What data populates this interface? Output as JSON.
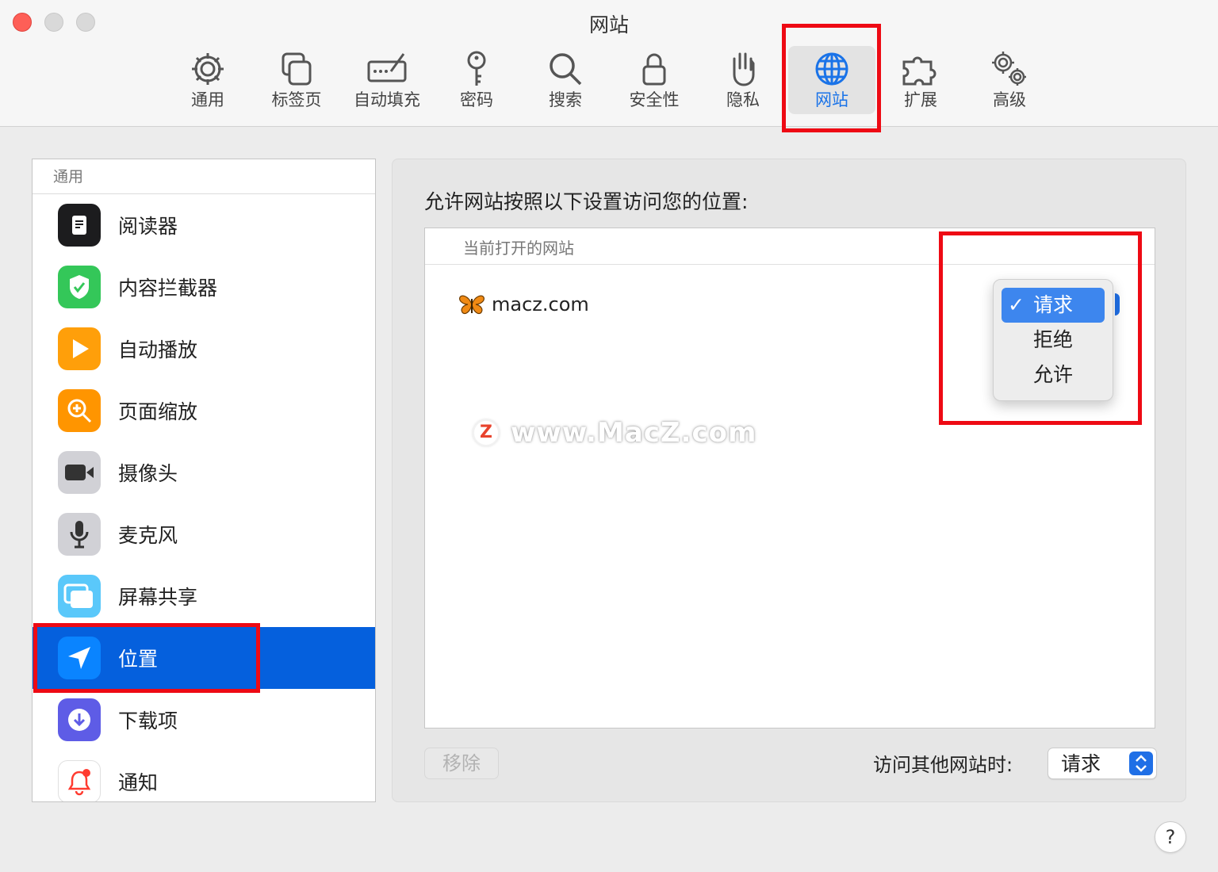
{
  "window": {
    "title": "网站"
  },
  "toolbar": {
    "items": [
      {
        "label": "通用",
        "icon": "gear-icon"
      },
      {
        "label": "标签页",
        "icon": "tabs-icon"
      },
      {
        "label": "自动填充",
        "icon": "autofill-icon"
      },
      {
        "label": "密码",
        "icon": "key-icon"
      },
      {
        "label": "搜索",
        "icon": "search-icon"
      },
      {
        "label": "安全性",
        "icon": "lock-icon"
      },
      {
        "label": "隐私",
        "icon": "hand-icon"
      },
      {
        "label": "网站",
        "icon": "globe-icon",
        "active": true
      },
      {
        "label": "扩展",
        "icon": "puzzle-icon"
      },
      {
        "label": "高级",
        "icon": "gears-icon"
      }
    ]
  },
  "sidebar": {
    "header": "通用",
    "items": [
      {
        "label": "阅读器",
        "icon": "reader-icon",
        "color": "#1c1c1e"
      },
      {
        "label": "内容拦截器",
        "icon": "shield-check-icon",
        "color": "#34c759"
      },
      {
        "label": "自动播放",
        "icon": "play-icon",
        "color": "#ff9f0a"
      },
      {
        "label": "页面缩放",
        "icon": "zoom-icon",
        "color": "#ff9500"
      },
      {
        "label": "摄像头",
        "icon": "camera-icon",
        "color": "#8e8e93"
      },
      {
        "label": "麦克风",
        "icon": "microphone-icon",
        "color": "#aeaeb2"
      },
      {
        "label": "屏幕共享",
        "icon": "screen-share-icon",
        "color": "#5ac8fa"
      },
      {
        "label": "位置",
        "icon": "location-arrow-icon",
        "color": "#0a84ff",
        "selected": true
      },
      {
        "label": "下载项",
        "icon": "download-icon",
        "color": "#5e5ce6"
      },
      {
        "label": "通知",
        "icon": "bell-icon",
        "color": "#ff3b30"
      }
    ]
  },
  "panel": {
    "caption": "允许网站按照以下设置访问您的位置:",
    "list_header": "当前打开的网站",
    "site": {
      "name": "macz.com",
      "icon": "butterfly-icon"
    },
    "dropdown": {
      "options": [
        "请求",
        "拒绝",
        "允许"
      ],
      "selected": "请求",
      "check": "✓"
    },
    "watermark": {
      "logo": "Z",
      "text": "www.MacZ.com"
    },
    "remove_button": "移除",
    "other_sites_label": "访问其他网站时:",
    "other_sites_value": "请求"
  },
  "help": {
    "label": "?"
  },
  "colors": {
    "accent": "#0560dd",
    "highlight_box": "#ee0a14",
    "menu_selection": "#3d86ee"
  }
}
